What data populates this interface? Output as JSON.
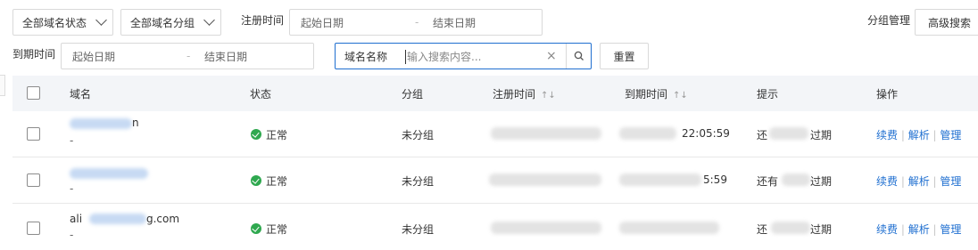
{
  "filters": {
    "domain_status": "全部域名状态",
    "domain_group": "全部域名分组",
    "register_time_label": "注册时间",
    "start_date": "起始日期",
    "range_dash": "-",
    "end_date": "结束日期",
    "expire_time_label": "到期时间",
    "expire_start_date": "起始日期",
    "expire_end_date": "结束日期",
    "search_field": "域名名称",
    "search_placeholder": "输入搜索内容...",
    "reset": "重置",
    "group_manage": "分组管理",
    "advanced_search": "高级搜索"
  },
  "table": {
    "headers": {
      "domain": "域名",
      "status": "状态",
      "group": "分组",
      "register_time": "注册时间",
      "expire_time": "到期时间",
      "tip": "提示",
      "actions": "操作"
    },
    "sort_symbol": "↑↓",
    "rows": [
      {
        "domain_visible": "n",
        "domain_sub": "-",
        "status": "正常",
        "group": "未分组",
        "expire_visible": "22:05:59",
        "tip_start": "还",
        "tip_end": "过期",
        "actions": [
          "续费",
          "解析",
          "管理"
        ]
      },
      {
        "domain_visible": "",
        "domain_sub": "-",
        "status": "正常",
        "group": "未分组",
        "expire_visible": "5:59",
        "tip_start": "还有",
        "tip_end": "过期",
        "actions": [
          "续费",
          "解析",
          "管理"
        ]
      },
      {
        "domain_visible": "ali",
        "domain_visible_end": "g.com",
        "domain_sub": "-",
        "status": "正常",
        "group": "未分组",
        "expire_visible": "",
        "tip_start": "还",
        "tip_end": "过期",
        "actions": [
          "续费",
          "解析",
          "管理"
        ]
      }
    ]
  },
  "colors": {
    "link": "#1f6fd0",
    "status_ok": "#2fa84f",
    "header_bg": "#f3f5f8"
  },
  "icons": [
    "chevron-down-icon",
    "close-icon",
    "search-icon",
    "check-circle-icon",
    "sort-icon"
  ]
}
